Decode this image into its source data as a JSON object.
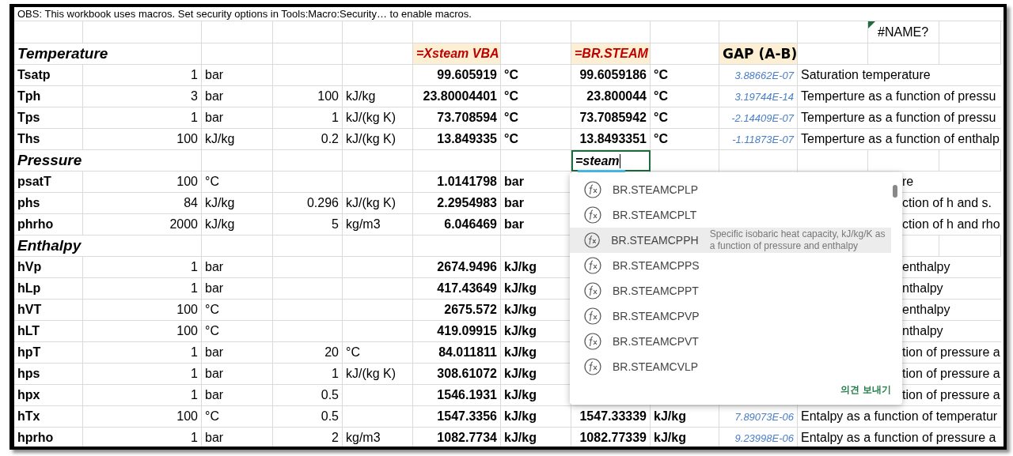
{
  "notice": "OBS: This workbook uses macros. Set security options in Tools:Macro:Security… to enable macros.",
  "name_error": {
    "text": "#NAME?",
    "comment": true
  },
  "sections": [
    {
      "title": "Temperature",
      "compare_headers": {
        "xsteam": "=Xsteam VBA",
        "brsteam": "=BR.STEAM",
        "gap": "GAP (A-B)"
      },
      "rows": [
        {
          "name": "Tsatp",
          "in1": "1",
          "in1_unit": "bar",
          "xsteam": "99.605919",
          "xsteam_unit": "°C",
          "brsteam": "99.6059186",
          "brsteam_unit": "°C",
          "gap": "3.88662E-07",
          "description": "Saturation temperature",
          "covered": false
        },
        {
          "name": "Tph",
          "in1": "3",
          "in1_unit": "bar",
          "in2": "100",
          "in2_unit": "kJ/kg",
          "xsteam": "23.80004401",
          "xsteam_unit": "°C",
          "brsteam": "23.800044",
          "brsteam_unit": "°C",
          "gap": "3.19744E-14",
          "description": "Temperture as a function of pressu",
          "covered": false
        },
        {
          "name": "Tps",
          "in1": "1",
          "in1_unit": "bar",
          "in2": "1",
          "in2_unit": "kJ/(kg K)",
          "xsteam": "73.708594",
          "xsteam_unit": "°C",
          "brsteam": "73.7085942",
          "brsteam_unit": "°C",
          "gap": "-2.14409E-07",
          "description": "Temperture as a function of pressu",
          "covered": false
        },
        {
          "name": "Ths",
          "in1": "100",
          "in1_unit": "kJ/kg",
          "in2": "0.2",
          "in2_unit": "kJ/(kg K)",
          "xsteam": "13.849335",
          "xsteam_unit": "°C",
          "brsteam": "13.8493351",
          "brsteam_unit": "°C",
          "gap": "-1.11873E-07",
          "description": "Temperture as a function of enthalp",
          "covered": false
        }
      ]
    },
    {
      "title": "Pressure",
      "editing_cell": {
        "value": "=steam"
      },
      "rows": [
        {
          "name": "psatT",
          "in1": "100",
          "in1_unit": "°C",
          "xsteam": "1.0141798",
          "xsteam_unit": "bar",
          "description": "re",
          "covered": true
        },
        {
          "name": "phs",
          "in1": "84",
          "in1_unit": "kJ/kg",
          "in2": "0.296",
          "in2_unit": "kJ/(kg K)",
          "xsteam": "2.2954983",
          "xsteam_unit": "bar",
          "description": "ction of h and s.",
          "covered": true
        },
        {
          "name": "phrho",
          "in1": "2000",
          "in1_unit": "kJ/kg",
          "in2": "5",
          "in2_unit": "kg/m3",
          "xsteam": "6.046469",
          "xsteam_unit": "bar",
          "description": "ction of h and rho",
          "covered": true
        }
      ]
    },
    {
      "title": "Enthalpy",
      "rows": [
        {
          "name": "hVp",
          "in1": "1",
          "in1_unit": "bar",
          "xsteam": "2674.9496",
          "xsteam_unit": "kJ/kg",
          "description": "enthalpy",
          "covered": true
        },
        {
          "name": "hLp",
          "in1": "1",
          "in1_unit": "bar",
          "xsteam": "417.43649",
          "xsteam_unit": "kJ/kg",
          "description": "nthalpy",
          "covered": true
        },
        {
          "name": "hVT",
          "in1": "100",
          "in1_unit": "°C",
          "xsteam": "2675.572",
          "xsteam_unit": "kJ/kg",
          "description": "enthalpy",
          "covered": true
        },
        {
          "name": "hLT",
          "in1": "100",
          "in1_unit": "°C",
          "xsteam": "419.09915",
          "xsteam_unit": "kJ/kg",
          "description": "nthalpy",
          "covered": true
        },
        {
          "name": "hpT",
          "in1": "1",
          "in1_unit": "bar",
          "in2": "20",
          "in2_unit": "°C",
          "xsteam": "84.011811",
          "xsteam_unit": "kJ/kg",
          "description": "tion of pressure a",
          "covered": true
        },
        {
          "name": "hps",
          "in1": "1",
          "in1_unit": "bar",
          "in2": "1",
          "in2_unit": "kJ/(kg K)",
          "xsteam": "308.61072",
          "xsteam_unit": "kJ/kg",
          "description": "tion of pressure a",
          "covered": true
        },
        {
          "name": "hpx",
          "in1": "1",
          "in1_unit": "bar",
          "in2": "0.5",
          "xsteam": "1546.1931",
          "xsteam_unit": "kJ/kg",
          "description": "tion of pressure a",
          "covered": true
        },
        {
          "name": "hTx",
          "in1": "100",
          "in1_unit": "°C",
          "in2": "0.5",
          "xsteam": "1547.3356",
          "xsteam_unit": "kJ/kg",
          "brsteam": "1547.33339",
          "brsteam_unit": "kJ/kg",
          "gap": "7.89073E-06",
          "description": "Entalpy as a function of temperatur",
          "covered": false
        },
        {
          "name": "hprho",
          "in1": "1",
          "in1_unit": "bar",
          "in2": "2",
          "in2_unit": "kg/m3",
          "xsteam": "1082.7734",
          "xsteam_unit": "kJ/kg",
          "brsteam": "1082.77339",
          "brsteam_unit": "kJ/kg",
          "gap": "9.23998E-06",
          "description": "Entalpy as a function of pressure a",
          "covered": false
        }
      ]
    }
  ],
  "autocomplete": {
    "items": [
      {
        "name": "BR.STEAMCPLP",
        "selected": false
      },
      {
        "name": "BR.STEAMCPLT",
        "selected": false
      },
      {
        "name": "BR.STEAMCPPH",
        "selected": true,
        "description": "Specific isobaric heat capacity, kJ/kg/K as a function of pressure and enthalpy"
      },
      {
        "name": "BR.STEAMCPPS",
        "selected": false
      },
      {
        "name": "BR.STEAMCPPT",
        "selected": false
      },
      {
        "name": "BR.STEAMCPVP",
        "selected": false
      },
      {
        "name": "BR.STEAMCPVT",
        "selected": false
      },
      {
        "name": "BR.STEAMCVLP",
        "selected": false
      }
    ],
    "feedback": "의견 보내기"
  }
}
